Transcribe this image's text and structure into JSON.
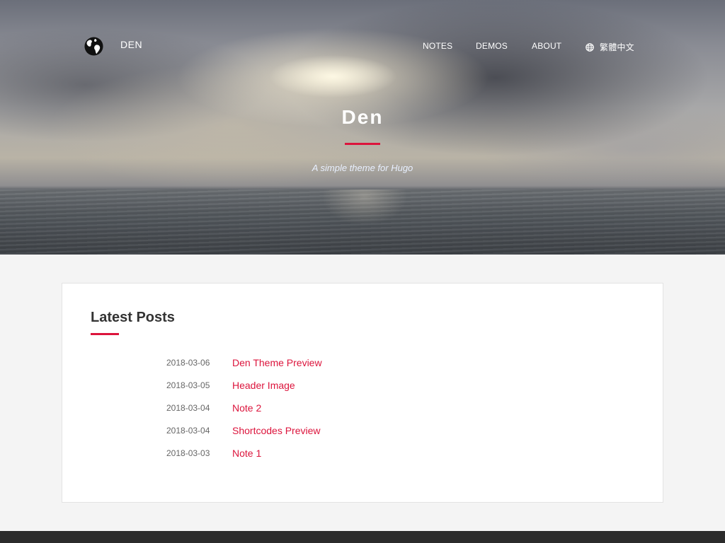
{
  "header": {
    "brand": "DEN",
    "nav": {
      "notes": "NOTES",
      "demos": "DEMOS",
      "about": "ABOUT",
      "language": "繁體中文"
    },
    "title": "Den",
    "subtitle": "A simple theme for Hugo"
  },
  "main": {
    "section_title": "Latest Posts",
    "posts": [
      {
        "date": "2018-03-06",
        "title": "Den Theme Preview"
      },
      {
        "date": "2018-03-05",
        "title": "Header Image"
      },
      {
        "date": "2018-03-04",
        "title": "Note 2"
      },
      {
        "date": "2018-03-04",
        "title": "Shortcodes Preview"
      },
      {
        "date": "2018-03-03",
        "title": "Note 1"
      }
    ]
  },
  "colors": {
    "accent": "#dc143c",
    "footer": "#2b2b2b",
    "page_background": "#f4f4f4"
  },
  "icons": {
    "logo": "globe-earth-icon",
    "language": "globe-icon"
  }
}
